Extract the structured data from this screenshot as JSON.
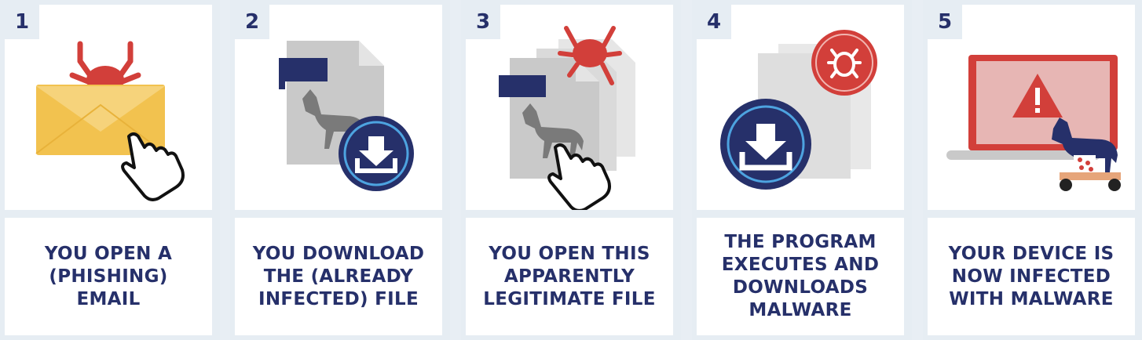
{
  "colors": {
    "navy": "#26306a",
    "red": "#d23f3a",
    "yellow": "#f2c24f",
    "gray": "#c9c9c9",
    "panel": "#e6edf3"
  },
  "steps": [
    {
      "number": "1",
      "caption": "YOU OPEN A\n(PHISHING)\nEMAIL",
      "icons": [
        "bug-icon",
        "envelope-icon",
        "hand-cursor-icon"
      ]
    },
    {
      "number": "2",
      "caption": "YOU DOWNLOAD\nTHE (ALREADY\nINFECTED) FILE",
      "icons": [
        "trojan-file-icon",
        "download-icon"
      ]
    },
    {
      "number": "3",
      "caption": "YOU OPEN THIS\nAPPARENTLY\nLEGITIMATE FILE",
      "icons": [
        "trojan-file-icon",
        "bug-icon",
        "hand-cursor-icon"
      ]
    },
    {
      "number": "4",
      "caption": "THE PROGRAM\nEXECUTES AND\nDOWNLOADS\nMALWARE",
      "icons": [
        "document-icon",
        "malware-bug-icon",
        "download-icon"
      ]
    },
    {
      "number": "5",
      "caption": "YOUR DEVICE IS\nNOW INFECTED\nWITH MALWARE",
      "icons": [
        "laptop-warning-icon",
        "trojan-horse-icon"
      ]
    }
  ]
}
